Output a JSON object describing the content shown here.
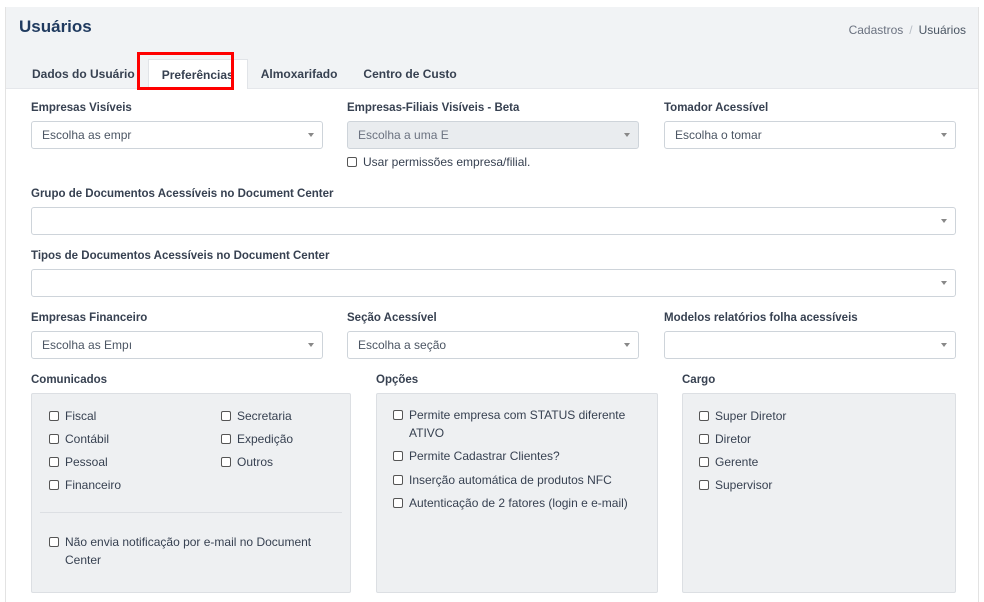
{
  "header": {
    "title": "Usuários",
    "breadcrumb": [
      "Cadastros",
      "Usuários"
    ]
  },
  "tabs": [
    {
      "label": "Dados do Usuário",
      "active": false
    },
    {
      "label": "Preferências",
      "active": true
    },
    {
      "label": "Almoxarifado",
      "active": false
    },
    {
      "label": "Centro de Custo",
      "active": false
    }
  ],
  "fields": {
    "empresas_visiveis": {
      "label": "Empresas Visíveis",
      "placeholder": "Escolha as empr"
    },
    "empresas_filiais": {
      "label": "Empresas-Filiais Visíveis - Beta",
      "placeholder": "Escolha a uma E",
      "checkbox": "Usar permissões empresa/filial."
    },
    "tomador": {
      "label": "Tomador Acessível",
      "placeholder": "Escolha o tomar"
    },
    "grupo_documentos": {
      "label": "Grupo de Documentos Acessíveis no Document Center",
      "value": ""
    },
    "tipos_documentos": {
      "label": "Tipos de Documentos Acessíveis no Document Center",
      "value": ""
    },
    "empresas_financeiro": {
      "label": "Empresas Financeiro",
      "placeholder": "Escolha as Empı"
    },
    "secao": {
      "label": "Seção Acessível",
      "placeholder": "Escolha a seção"
    },
    "modelos_relatorios": {
      "label": "Modelos relatórios folha acessíveis",
      "value": ""
    }
  },
  "comunicados": {
    "label": "Comunicados",
    "items": [
      "Fiscal",
      "Secretaria",
      "Contábil",
      "Expedição",
      "Pessoal",
      "Outros",
      "Financeiro"
    ],
    "notify": "Não envia notificação por e-mail no Document Center"
  },
  "opcoes": {
    "label": "Opções",
    "items": [
      "Permite empresa com STATUS diferente ATIVO",
      "Permite Cadastrar Clientes?",
      "Inserção automática de produtos NFC",
      "Autenticação de 2 fatores (login e e-mail)"
    ]
  },
  "cargo": {
    "label": "Cargo",
    "items": [
      "Super Diretor",
      "Diretor",
      "Gerente",
      "Supervisor"
    ]
  }
}
